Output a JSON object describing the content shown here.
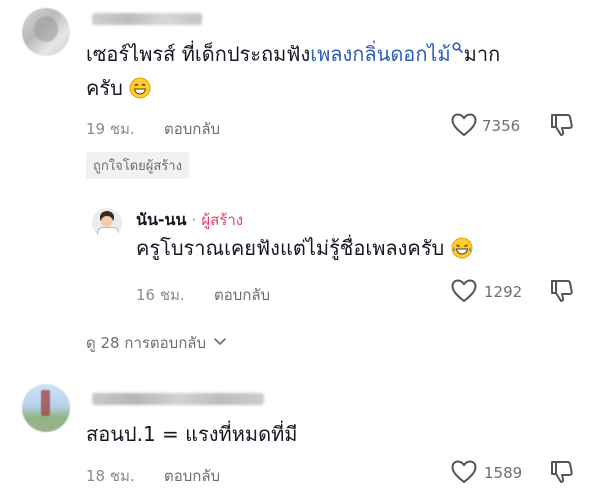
{
  "comments": [
    {
      "text_before": "เซอร์ไพรส์ ที่เด็กประถมฟัง",
      "keyword": "เพลงกลิ่นดอกไม้",
      "text_after_line1": "มาก",
      "text_line2": "ครับ",
      "time": "19 ชม.",
      "reply_label": "ตอบกลับ",
      "likes": "7356",
      "liked_by_creator": "ถูกใจโดยผู้สร้าง"
    },
    {
      "author": "นัน-นน",
      "separator": "·",
      "creator_tag": "ผู้สร้าง",
      "text": "ครูโบราณเคยฟังแต่ไม่รู้ชื่อเพลงครับ",
      "time": "16 ชม.",
      "reply_label": "ตอบกลับ",
      "likes": "1292"
    },
    {
      "text": "สอนป.1 = แรงที่หมดที่มี",
      "time": "18 ชม.",
      "reply_label": "ตอบกลับ",
      "likes": "1589"
    }
  ],
  "view_replies": "ดู 28 การตอบกลับ",
  "colors": {
    "keyword": "#2b5db9",
    "creator": "#e53f6a",
    "muted": "#8a8b91"
  }
}
